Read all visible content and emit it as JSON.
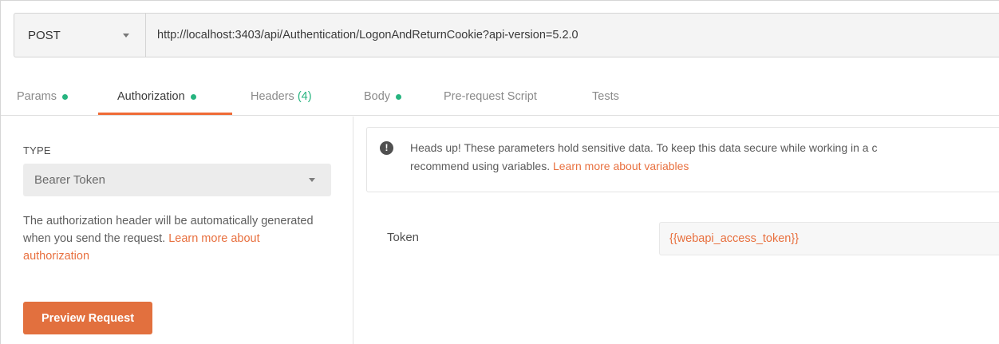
{
  "request": {
    "method": "POST",
    "url": "http://localhost:3403/api/Authentication/LogonAndReturnCookie?api-version=5.2.0"
  },
  "tabs": [
    {
      "label": "Params",
      "dot": true
    },
    {
      "label": "Authorization",
      "dot": true,
      "active": true
    },
    {
      "label": "Headers",
      "count": "(4)"
    },
    {
      "label": "Body",
      "dot": true
    },
    {
      "label": "Pre-request Script"
    },
    {
      "label": "Tests"
    }
  ],
  "auth": {
    "type_label": "TYPE",
    "type_value": "Bearer Token",
    "description": "The authorization header will be automatically generated when you send the request. ",
    "description_link": "Learn more about authorization",
    "preview_button": "Preview Request"
  },
  "notice": {
    "icon": "exclamation-icon",
    "line1": "Heads up! These parameters hold sensitive data. To keep this data secure while working in a c",
    "line2": "recommend using variables. ",
    "link": "Learn more about variables"
  },
  "token": {
    "label": "Token",
    "value": "{{webapi_access_token}}"
  },
  "colors": {
    "accent": "#e2703e",
    "status_dot": "#26b47f"
  }
}
